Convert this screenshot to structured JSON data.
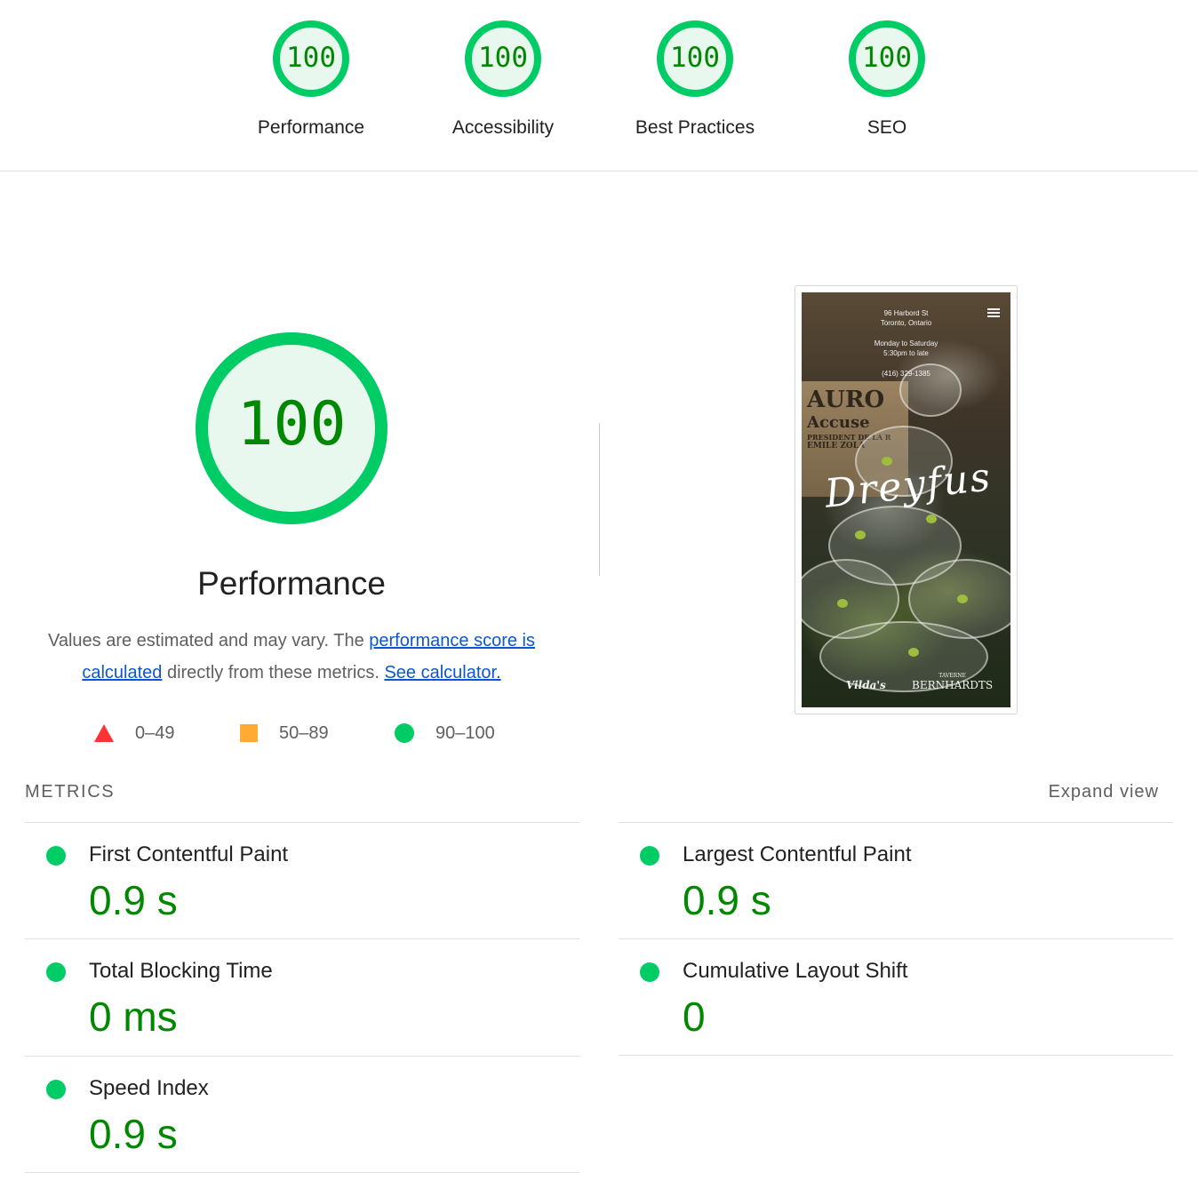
{
  "colors": {
    "pass": "#00cc66",
    "pass_text": "#008800",
    "pass_fill": "#e8f8ee",
    "average": "#ffaa33",
    "fail": "#ff3333",
    "link": "#0b57d0"
  },
  "categories": [
    {
      "label": "Performance",
      "score": "100"
    },
    {
      "label": "Accessibility",
      "score": "100"
    },
    {
      "label": "Best Practices",
      "score": "100"
    },
    {
      "label": "SEO",
      "score": "100"
    }
  ],
  "performance": {
    "score": "100",
    "title": "Performance",
    "desc_text1": "Values are estimated and may vary. The ",
    "desc_link1": "performance score is calculated",
    "desc_text2": " directly from these metrics. ",
    "desc_link2": "See calculator."
  },
  "legend": [
    {
      "shape": "triangle",
      "range": "0–49"
    },
    {
      "shape": "square",
      "range": "50–89"
    },
    {
      "shape": "circle",
      "range": "90–100"
    }
  ],
  "screenshot": {
    "address_line1": "96 Harbord St",
    "address_line2": "Toronto, Ontario",
    "hours_line1": "Monday to Saturday",
    "hours_line2": "5:30pm to late",
    "phone": "(416) 329-1385",
    "brand": "Dreyfus",
    "footer_left": "Vilda's",
    "footer_right_small": "TAVERNE",
    "footer_right": "BERNHARDTS",
    "poster_line1": "AURO",
    "poster_line2": "Accuse",
    "poster_line3": "PRESIDENT DE LA R",
    "poster_line4": "EMILE ZOLA"
  },
  "metrics": {
    "heading": "METRICS",
    "expand_label": "Expand view",
    "items": [
      {
        "title": "First Contentful Paint",
        "value": "0.9 s"
      },
      {
        "title": "Largest Contentful Paint",
        "value": "0.9 s"
      },
      {
        "title": "Total Blocking Time",
        "value": "0 ms"
      },
      {
        "title": "Cumulative Layout Shift",
        "value": "0"
      },
      {
        "title": "Speed Index",
        "value": "0.9 s"
      }
    ]
  }
}
